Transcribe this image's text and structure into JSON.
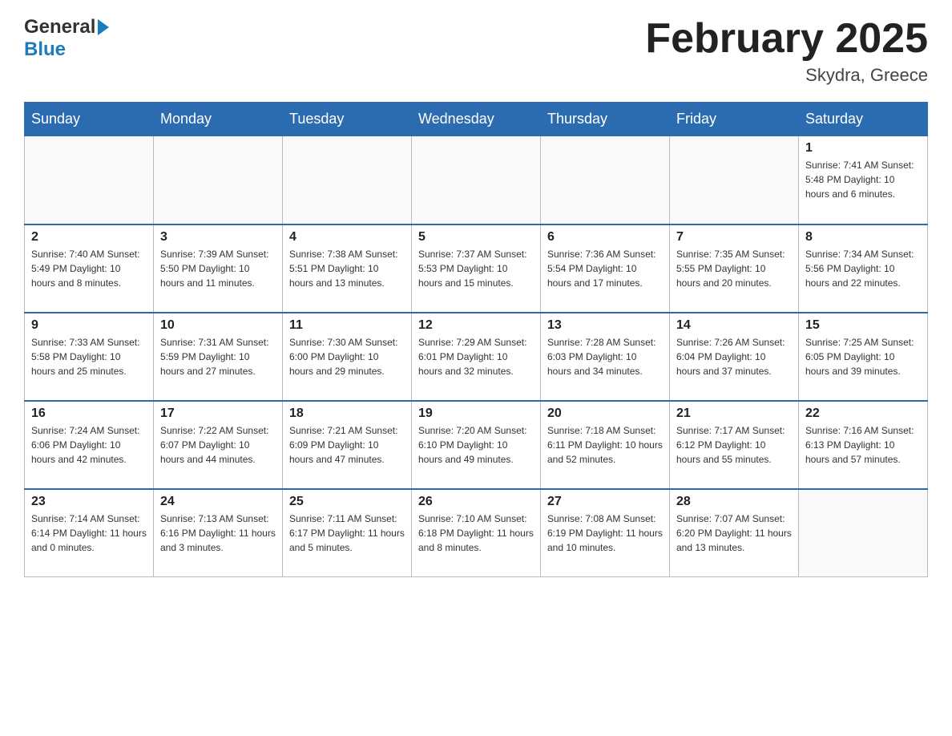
{
  "header": {
    "logo_general": "General",
    "logo_blue": "Blue",
    "month_title": "February 2025",
    "location": "Skydra, Greece"
  },
  "calendar": {
    "days_of_week": [
      "Sunday",
      "Monday",
      "Tuesday",
      "Wednesday",
      "Thursday",
      "Friday",
      "Saturday"
    ],
    "weeks": [
      {
        "days": [
          {
            "number": "",
            "info": ""
          },
          {
            "number": "",
            "info": ""
          },
          {
            "number": "",
            "info": ""
          },
          {
            "number": "",
            "info": ""
          },
          {
            "number": "",
            "info": ""
          },
          {
            "number": "",
            "info": ""
          },
          {
            "number": "1",
            "info": "Sunrise: 7:41 AM\nSunset: 5:48 PM\nDaylight: 10 hours and 6 minutes."
          }
        ]
      },
      {
        "days": [
          {
            "number": "2",
            "info": "Sunrise: 7:40 AM\nSunset: 5:49 PM\nDaylight: 10 hours and 8 minutes."
          },
          {
            "number": "3",
            "info": "Sunrise: 7:39 AM\nSunset: 5:50 PM\nDaylight: 10 hours and 11 minutes."
          },
          {
            "number": "4",
            "info": "Sunrise: 7:38 AM\nSunset: 5:51 PM\nDaylight: 10 hours and 13 minutes."
          },
          {
            "number": "5",
            "info": "Sunrise: 7:37 AM\nSunset: 5:53 PM\nDaylight: 10 hours and 15 minutes."
          },
          {
            "number": "6",
            "info": "Sunrise: 7:36 AM\nSunset: 5:54 PM\nDaylight: 10 hours and 17 minutes."
          },
          {
            "number": "7",
            "info": "Sunrise: 7:35 AM\nSunset: 5:55 PM\nDaylight: 10 hours and 20 minutes."
          },
          {
            "number": "8",
            "info": "Sunrise: 7:34 AM\nSunset: 5:56 PM\nDaylight: 10 hours and 22 minutes."
          }
        ]
      },
      {
        "days": [
          {
            "number": "9",
            "info": "Sunrise: 7:33 AM\nSunset: 5:58 PM\nDaylight: 10 hours and 25 minutes."
          },
          {
            "number": "10",
            "info": "Sunrise: 7:31 AM\nSunset: 5:59 PM\nDaylight: 10 hours and 27 minutes."
          },
          {
            "number": "11",
            "info": "Sunrise: 7:30 AM\nSunset: 6:00 PM\nDaylight: 10 hours and 29 minutes."
          },
          {
            "number": "12",
            "info": "Sunrise: 7:29 AM\nSunset: 6:01 PM\nDaylight: 10 hours and 32 minutes."
          },
          {
            "number": "13",
            "info": "Sunrise: 7:28 AM\nSunset: 6:03 PM\nDaylight: 10 hours and 34 minutes."
          },
          {
            "number": "14",
            "info": "Sunrise: 7:26 AM\nSunset: 6:04 PM\nDaylight: 10 hours and 37 minutes."
          },
          {
            "number": "15",
            "info": "Sunrise: 7:25 AM\nSunset: 6:05 PM\nDaylight: 10 hours and 39 minutes."
          }
        ]
      },
      {
        "days": [
          {
            "number": "16",
            "info": "Sunrise: 7:24 AM\nSunset: 6:06 PM\nDaylight: 10 hours and 42 minutes."
          },
          {
            "number": "17",
            "info": "Sunrise: 7:22 AM\nSunset: 6:07 PM\nDaylight: 10 hours and 44 minutes."
          },
          {
            "number": "18",
            "info": "Sunrise: 7:21 AM\nSunset: 6:09 PM\nDaylight: 10 hours and 47 minutes."
          },
          {
            "number": "19",
            "info": "Sunrise: 7:20 AM\nSunset: 6:10 PM\nDaylight: 10 hours and 49 minutes."
          },
          {
            "number": "20",
            "info": "Sunrise: 7:18 AM\nSunset: 6:11 PM\nDaylight: 10 hours and 52 minutes."
          },
          {
            "number": "21",
            "info": "Sunrise: 7:17 AM\nSunset: 6:12 PM\nDaylight: 10 hours and 55 minutes."
          },
          {
            "number": "22",
            "info": "Sunrise: 7:16 AM\nSunset: 6:13 PM\nDaylight: 10 hours and 57 minutes."
          }
        ]
      },
      {
        "days": [
          {
            "number": "23",
            "info": "Sunrise: 7:14 AM\nSunset: 6:14 PM\nDaylight: 11 hours and 0 minutes."
          },
          {
            "number": "24",
            "info": "Sunrise: 7:13 AM\nSunset: 6:16 PM\nDaylight: 11 hours and 3 minutes."
          },
          {
            "number": "25",
            "info": "Sunrise: 7:11 AM\nSunset: 6:17 PM\nDaylight: 11 hours and 5 minutes."
          },
          {
            "number": "26",
            "info": "Sunrise: 7:10 AM\nSunset: 6:18 PM\nDaylight: 11 hours and 8 minutes."
          },
          {
            "number": "27",
            "info": "Sunrise: 7:08 AM\nSunset: 6:19 PM\nDaylight: 11 hours and 10 minutes."
          },
          {
            "number": "28",
            "info": "Sunrise: 7:07 AM\nSunset: 6:20 PM\nDaylight: 11 hours and 13 minutes."
          },
          {
            "number": "",
            "info": ""
          }
        ]
      }
    ]
  }
}
